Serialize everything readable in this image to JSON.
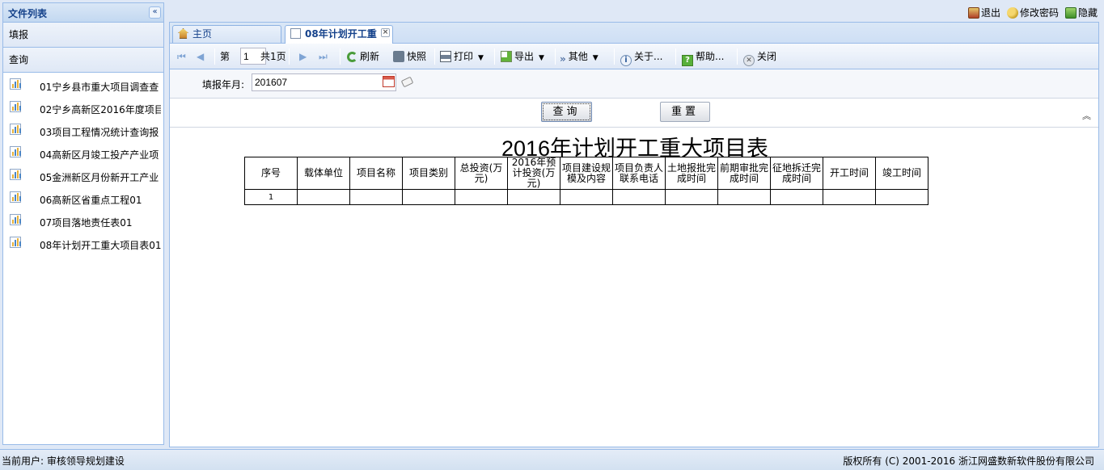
{
  "left_panel": {
    "title": "文件列表",
    "collapse_glyph": "«",
    "section_fill": "填报",
    "section_query": "查询",
    "files": [
      {
        "label": "01宁乡县市重大项目调查查"
      },
      {
        "label": "02宁乡高新区2016年度项目"
      },
      {
        "label": "03项目工程情况统计查询报"
      },
      {
        "label": "04高新区月竣工投产产业项"
      },
      {
        "label": "05金洲新区月份新开工产业"
      },
      {
        "label": "06高新区省重点工程01"
      },
      {
        "label": "07项目落地责任表01"
      },
      {
        "label": "08年计划开工重大项目表01"
      }
    ]
  },
  "top_actions": {
    "logout": "退出",
    "change_password": "修改密码",
    "hide": "隐藏"
  },
  "tabs": {
    "home": "主页",
    "active": "08年计划开工重",
    "close_glyph": "×"
  },
  "toolbar": {
    "first": "⏮",
    "prev": "◀",
    "page_prefix": "第",
    "page_value": "1",
    "page_total": "共1页",
    "next": "▶",
    "last": "⏭",
    "refresh": "刷新",
    "snapshot": "快照",
    "print": "打印",
    "export": "导出",
    "other": "其他",
    "about": "关于...",
    "help": "帮助...",
    "close": "关闭",
    "caret": "▼"
  },
  "params": {
    "year_label": "填报年月:",
    "year_value": "201607"
  },
  "buttons": {
    "query": "查询",
    "reset": "重置",
    "expand_glyph": "︽"
  },
  "report": {
    "title": "2016年计划开工重大项目表",
    "headers": [
      "序号",
      "载体单位",
      "项目名称",
      "项目类别",
      "总投资(万元)",
      "2016年预计投资(万元)",
      "项目建设规模及内容",
      "项目负责人联系电话",
      "土地报批完成时间",
      "前期审批完成时间",
      "征地拆迁完成时间",
      "开工时间",
      "竣工时间"
    ],
    "rows": [
      [
        "1",
        "",
        "",
        "",
        "",
        "",
        "",
        "",
        "",
        "",
        "",
        "",
        ""
      ]
    ]
  },
  "status": {
    "current_user": "当前用户: 审核领导规划建设",
    "copyright": "版权所有 (C) 2001-2016 浙江网盛数新软件股份有限公司"
  },
  "colors": {
    "panel_border": "#99bbe8",
    "header_text": "#15428b",
    "background": "#dfe8f6"
  }
}
